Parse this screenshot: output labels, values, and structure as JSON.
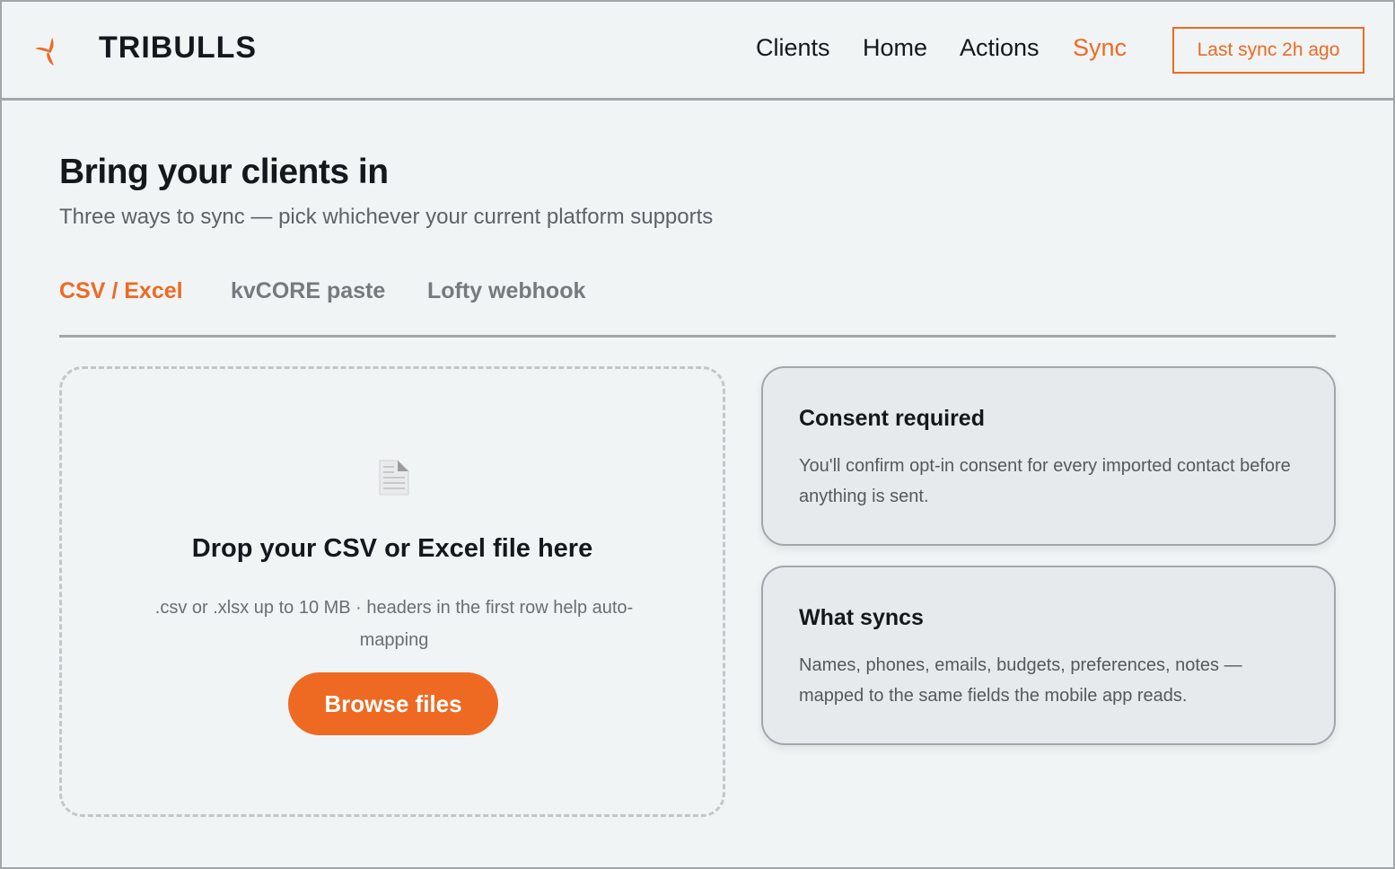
{
  "header": {
    "brand": "TRIBULLS",
    "logo_icon": "tri-blade-logo-icon",
    "nav": [
      {
        "label": "Clients",
        "active": false
      },
      {
        "label": "Home",
        "active": false
      },
      {
        "label": "Actions",
        "active": false
      },
      {
        "label": "Sync",
        "active": true
      }
    ],
    "sync_status": "Last sync 2h ago"
  },
  "main": {
    "title": "Bring your clients in",
    "subtitle": "Three ways to sync — pick whichever your current platform supports",
    "tabs": [
      {
        "label": "CSV / Excel",
        "active": true
      },
      {
        "label": "kvCORE paste",
        "active": false
      },
      {
        "label": "Lofty webhook",
        "active": false
      }
    ],
    "dropzone": {
      "icon": "document-icon",
      "title": "Drop your CSV or Excel file here",
      "hint": ".csv or .xlsx up to 10 MB · headers in the first row help auto-mapping",
      "button_label": "Browse files"
    },
    "cards": [
      {
        "title": "Consent required",
        "body": "You'll confirm opt-in consent for every imported contact before anything is sent."
      },
      {
        "title": "What syncs",
        "body": "Names, phones, emails, budgets, preferences, notes — mapped to the same fields the mobile app reads."
      }
    ]
  },
  "colors": {
    "accent": "#ee6a22",
    "background": "#f0f4f5",
    "card_background": "#e6eaec",
    "border": "#a3a6a8",
    "text": "#14181c",
    "muted_text": "#5e6166"
  }
}
